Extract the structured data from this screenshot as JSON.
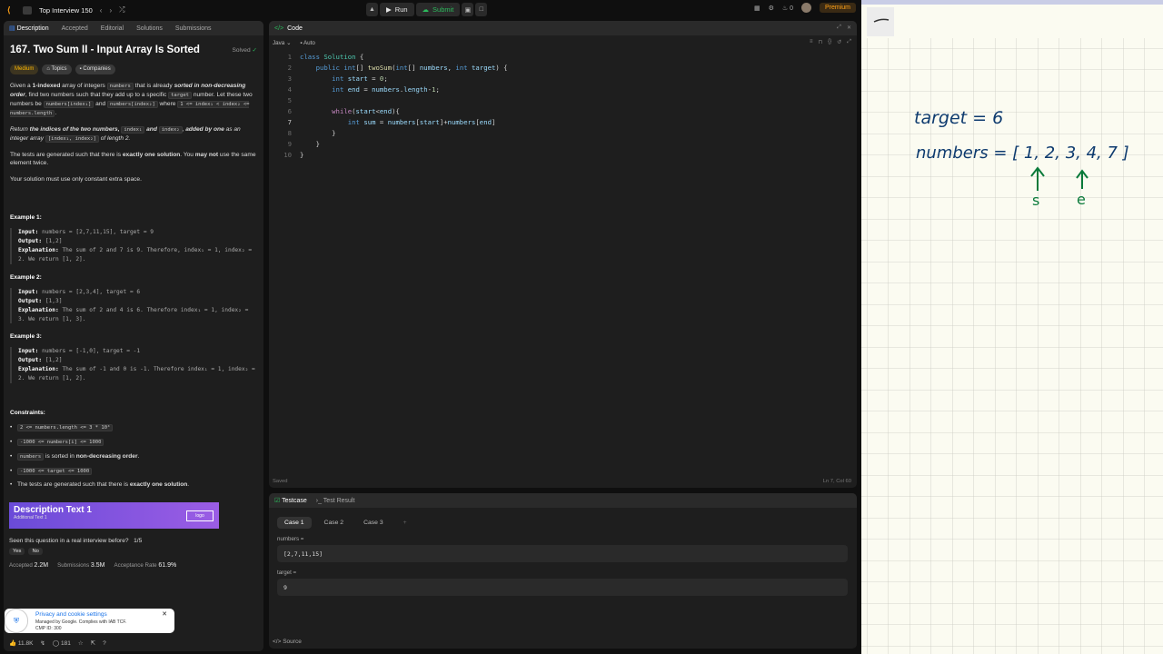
{
  "topbar": {
    "title": "Top Interview 150",
    "run": "Run",
    "submit": "Submit",
    "streak": "0",
    "premium": "Premium"
  },
  "tabs": [
    "Description",
    "Accepted",
    "Editorial",
    "Solutions",
    "Submissions"
  ],
  "problem": {
    "title": "167. Two Sum II - Input Array Is Sorted",
    "solved": "Solved",
    "difficulty": "Medium",
    "topics": "Topics",
    "companies": "Companies"
  },
  "examples": [
    {
      "head": "Example 1:",
      "input": "numbers = [2,7,11,15], target = 9",
      "output": "[1,2]",
      "exp": "The sum of 2 and 7 is 9. Therefore, index₁ = 1, index₂ = 2. We return [1, 2]."
    },
    {
      "head": "Example 2:",
      "input": "numbers = [2,3,4], target = 6",
      "output": "[1,3]",
      "exp": "The sum of 2 and 4 is 6. Therefore index₁ = 1, index₂ = 3. We return [1, 3]."
    },
    {
      "head": "Example 3:",
      "input": "numbers = [-1,0], target = -1",
      "output": "[1,2]",
      "exp": "The sum of -1 and 0 is -1. Therefore index₁ = 1, index₂ = 2. We return [1, 2]."
    }
  ],
  "constraints_head": "Constraints:",
  "ad": {
    "title": "Description Text 1",
    "sub": "Additional Text 1",
    "logo": "logo"
  },
  "feedback": {
    "q": "Seen this question in a real interview before?",
    "count": "1/5",
    "yes": "Yes",
    "no": "No"
  },
  "stats": {
    "acc_l": "Accepted",
    "acc": "2.2M",
    "sub_l": "Submissions",
    "sub": "3.5M",
    "rate_l": "Acceptance Rate",
    "rate": "61.9%"
  },
  "privacy": {
    "title": "Privacy and cookie settings",
    "line1": "Managed by Google. Complies with IAB TCF.",
    "line2": "CMP ID: 300"
  },
  "bottom": {
    "likes": "11.8K",
    "comments": "181"
  },
  "code": {
    "header": "Code",
    "lang": "Java",
    "mode": "Auto",
    "saved": "Saved",
    "cursor": "Ln 7, Col 60"
  },
  "testcase": {
    "tab1": "Testcase",
    "tab2": "Test Result",
    "cases": [
      "Case 1",
      "Case 2",
      "Case 3"
    ],
    "l1": "numbers =",
    "v1": "[2,7,11,15]",
    "l2": "target =",
    "v2": "9"
  },
  "source": "Source",
  "whiteboard": {
    "target": "target = 6",
    "numbers": "numbers = [ 1, 2, 3, 4, 7 ]",
    "s": "s",
    "e": "e"
  }
}
